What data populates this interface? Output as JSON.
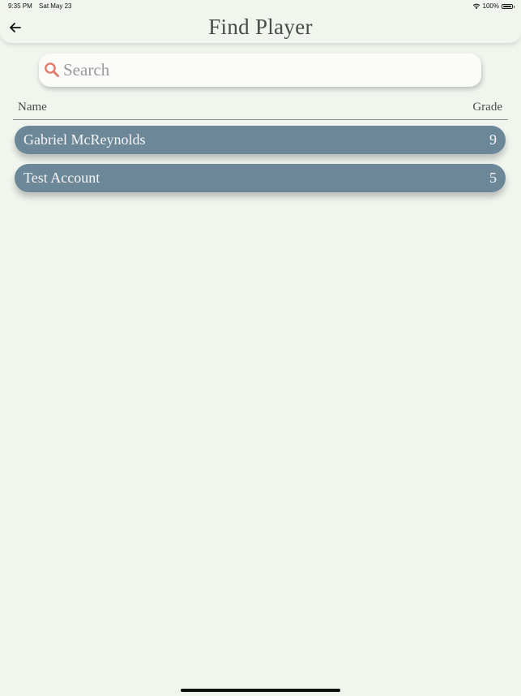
{
  "status_bar": {
    "time": "9:35 PM",
    "date": "Sat May 23",
    "battery": "100%",
    "battery_level": 1.0,
    "wifi_icon": "wifi-icon"
  },
  "header": {
    "title": "Find Player",
    "back_icon": "arrow-left-icon"
  },
  "search": {
    "placeholder": "Search",
    "value": "",
    "icon": "magnifier-icon",
    "icon_color": "#e07a6a"
  },
  "table": {
    "columns": [
      "Name",
      "Grade"
    ],
    "rows": [
      {
        "name": "Gabriel McReynolds",
        "grade": "9"
      },
      {
        "name": "Test Account",
        "grade": "5"
      }
    ]
  },
  "colors": {
    "background": "#f0f5ee",
    "row": "#6c8798",
    "row_text": "#f6f6f6"
  }
}
